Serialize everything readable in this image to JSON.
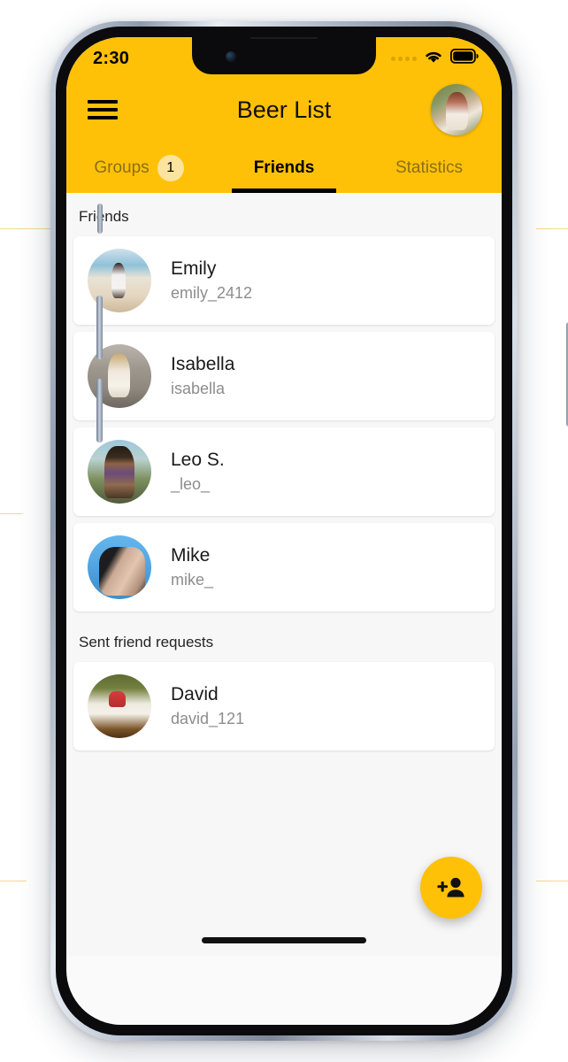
{
  "status_bar": {
    "time": "2:30",
    "signal_icon": "signal-dots-icon",
    "wifi_icon": "wifi-icon",
    "battery_icon": "battery-full-icon"
  },
  "header": {
    "menu_icon": "hamburger-menu-icon",
    "title": "Beer List",
    "avatar_icon": "profile-avatar"
  },
  "tabs": [
    {
      "label": "Groups",
      "active": false,
      "badge": "1"
    },
    {
      "label": "Friends",
      "active": true,
      "badge": null
    },
    {
      "label": "Statistics",
      "active": false,
      "badge": null
    }
  ],
  "sections": [
    {
      "title": "Friends",
      "items": [
        {
          "name": "Emily",
          "handle": "emily_2412",
          "avatar": "av-emily"
        },
        {
          "name": "Isabella",
          "handle": "isabella",
          "avatar": "av-isabella"
        },
        {
          "name": "Leo S.",
          "handle": "_leo_",
          "avatar": "av-leo"
        },
        {
          "name": "Mike",
          "handle": "mike_",
          "avatar": "av-mike"
        }
      ]
    },
    {
      "title": "Sent friend requests",
      "items": [
        {
          "name": "David",
          "handle": "david_121",
          "avatar": "av-david"
        }
      ]
    }
  ],
  "fab": {
    "icon": "person-add-icon",
    "label": "Add friend"
  },
  "colors": {
    "accent_yellow": "#FFC107",
    "badge_yellow": "#FBE3A0",
    "tab_inactive": "#8A6F14",
    "content_bg": "#F7F7F7",
    "card_bg": "#FFFFFF",
    "name_text": "#1A1A1A",
    "handle_text": "#8D8D8D"
  }
}
